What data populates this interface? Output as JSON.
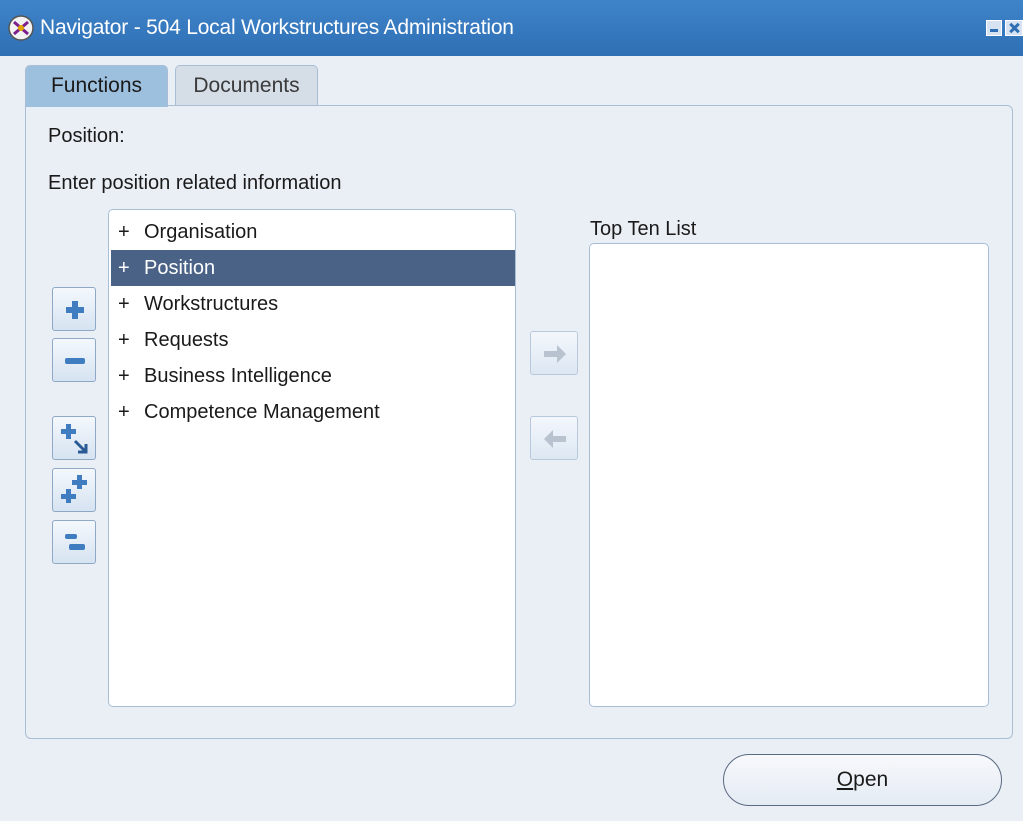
{
  "window": {
    "title": "Navigator - 504 Local Workstructures Administration"
  },
  "tabs": [
    {
      "label": "Functions",
      "active": true
    },
    {
      "label": "Documents",
      "active": false
    }
  ],
  "panel": {
    "section_label": "Position:",
    "instruction": "Enter position related information",
    "top_ten_label": "Top Ten List"
  },
  "function_list": [
    {
      "prefix": "+",
      "label": "Organisation",
      "selected": false
    },
    {
      "prefix": "+",
      "label": "Position",
      "selected": true
    },
    {
      "prefix": "+",
      "label": "Workstructures",
      "selected": false
    },
    {
      "prefix": "+",
      "label": "Requests",
      "selected": false
    },
    {
      "prefix": "+",
      "label": "Business Intelligence",
      "selected": false
    },
    {
      "prefix": "+",
      "label": "Competence Management",
      "selected": false
    }
  ],
  "tree_buttons": [
    "expand-icon",
    "collapse-icon",
    "expand-branch-icon",
    "expand-all-icon",
    "collapse-all-icon"
  ],
  "transfer_buttons": [
    "arrow-right-icon",
    "arrow-left-icon"
  ],
  "open_button": {
    "mnemonic": "O",
    "rest": "pen"
  },
  "colors": {
    "titlebar": "#2f6fb4",
    "selection": "#4a6286",
    "active_tab": "#9ec0df",
    "background": "#eaeef5"
  }
}
